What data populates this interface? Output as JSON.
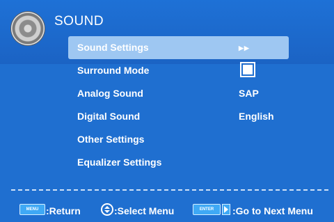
{
  "header": {
    "title": "SOUND"
  },
  "menu": {
    "items": [
      {
        "label": "Sound Settings"
      },
      {
        "label": "Surround Mode"
      },
      {
        "label": "Analog Sound",
        "value": "SAP"
      },
      {
        "label": "Digital Sound",
        "value": "English"
      },
      {
        "label": "Other Settings"
      },
      {
        "label": "Equalizer Settings"
      }
    ]
  },
  "footer": {
    "menu_key": "MENU",
    "return_label": ":Return",
    "select_label": ":Select Menu",
    "enter_key": "ENTER",
    "next_label": ":Go to Next Menu"
  },
  "icons": {
    "header": "speaker-icon",
    "submenu": "double-arrow-right-icon",
    "surround_state": "checkbox-checked-icon",
    "select": "up-down-icon",
    "next": "arrow-right-icon"
  },
  "colors": {
    "background": "#1f6fd0",
    "highlight": "#9ec7f2",
    "key": "#3fa9f5"
  }
}
